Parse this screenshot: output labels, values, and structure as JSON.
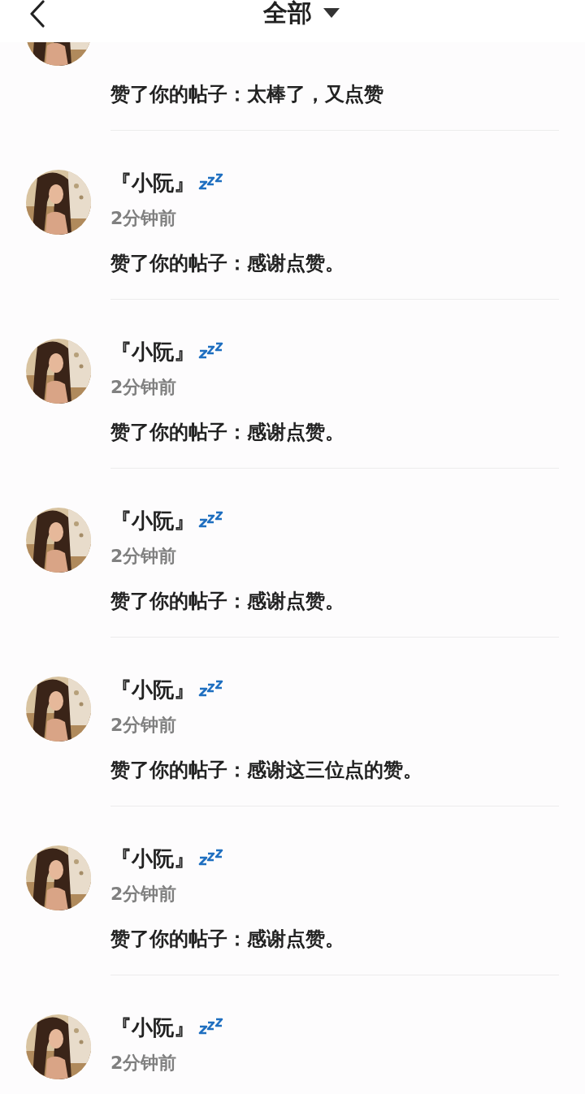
{
  "header": {
    "title": "全部"
  },
  "notifications": [
    {
      "kind": "partial",
      "message": "赞了你的帖子：太棒了，又点赞"
    },
    {
      "kind": "full",
      "name": "『小阮』",
      "sleeping": true,
      "time": "2分钟前",
      "message": "赞了你的帖子：感谢点赞。"
    },
    {
      "kind": "full",
      "name": "『小阮』",
      "sleeping": true,
      "time": "2分钟前",
      "message": "赞了你的帖子：感谢点赞。"
    },
    {
      "kind": "full",
      "name": "『小阮』",
      "sleeping": true,
      "time": "2分钟前",
      "message": "赞了你的帖子：感谢点赞。"
    },
    {
      "kind": "full",
      "name": "『小阮』",
      "sleeping": true,
      "time": "2分钟前",
      "message": "赞了你的帖子：感谢这三位点的赞。"
    },
    {
      "kind": "full",
      "name": "『小阮』",
      "sleeping": true,
      "time": "2分钟前",
      "message": "赞了你的帖子：感谢点赞。"
    },
    {
      "kind": "full",
      "name": "『小阮』",
      "sleeping": true,
      "time": "2分钟前"
    }
  ]
}
